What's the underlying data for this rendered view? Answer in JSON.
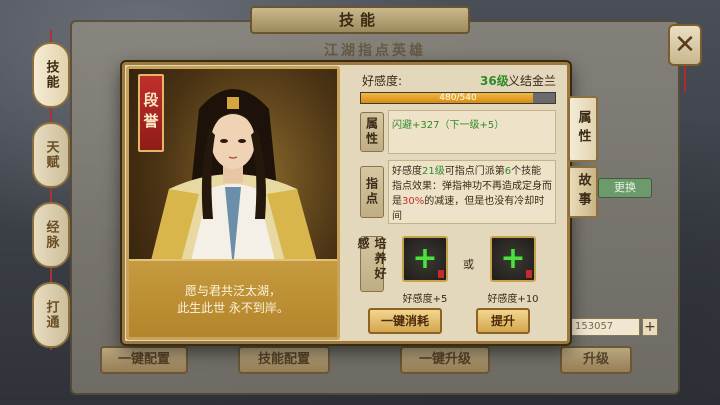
{
  "background": {
    "title": "技能",
    "subtitle": "江湖指点英雄",
    "left_tabs": [
      "技能",
      "天赋",
      "经脉",
      "打通"
    ],
    "bottom_buttons": [
      "一键配置",
      "技能配置",
      "一键升级",
      "升级"
    ],
    "num_value": "153057",
    "plus_label": "+",
    "green_button": "更换"
  },
  "portrait": {
    "name": "段誉",
    "caption_line1": "愿与君共泛太湖，",
    "caption_line2": "此生此世 永不到岸。"
  },
  "favor": {
    "label": "好感度:",
    "level": "36级",
    "title_name": "义结金兰",
    "progress_text": "480/540",
    "progress_fraction": 0.889
  },
  "sections": {
    "attr_label": "属性",
    "attr_value": "闪避+327（下一级+5）",
    "guide_label": "指点",
    "guide_pre": "好感度",
    "guide_level": "21级",
    "guide_mid": "可指点门派第",
    "guide_num": "6",
    "guide_post": "个技能",
    "guide_effect_pre": "指点效果：弹指神功不再造成定身而是",
    "guide_percent": "30%",
    "guide_effect_post": "的减速，但是也没有冷却时间",
    "cultivate_label": "培养好感"
  },
  "items": {
    "or_text": "或",
    "item1_label": "好感度+5",
    "item2_label": "好感度+10"
  },
  "buttons": {
    "one_click": "一键消耗",
    "upgrade": "提升"
  },
  "side_tabs": {
    "attr": "属性",
    "story": "故事"
  },
  "colors": {
    "accent_green": "#2f8a2a",
    "progress_orange": "#e09a20",
    "name_red": "#c0302b",
    "frame_gold": "#c8a45a"
  },
  "icons": {
    "item_icon": "green-plus-icon",
    "close_icon": "close-icon"
  }
}
